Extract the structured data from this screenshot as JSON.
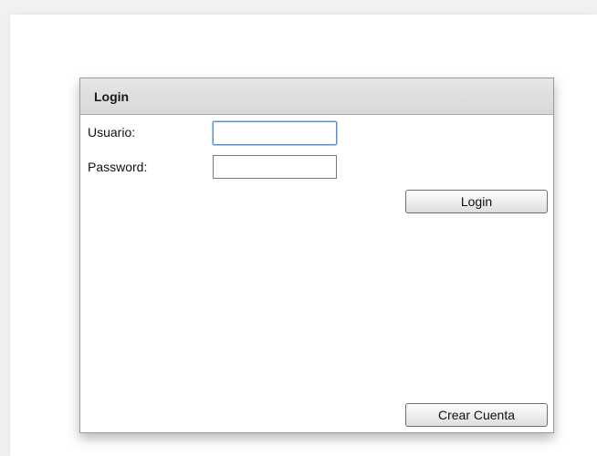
{
  "panel": {
    "title": "Login"
  },
  "form": {
    "usuario_label": "Usuario:",
    "usuario_value": "",
    "password_label": "Password:",
    "password_value": "",
    "login_button": "Login",
    "create_account_button": "Crear Cuenta"
  },
  "colors": {
    "header_bg": "#dcdcdc",
    "focus_border": "#5a8fd0",
    "page_bg": "#ffffff"
  }
}
